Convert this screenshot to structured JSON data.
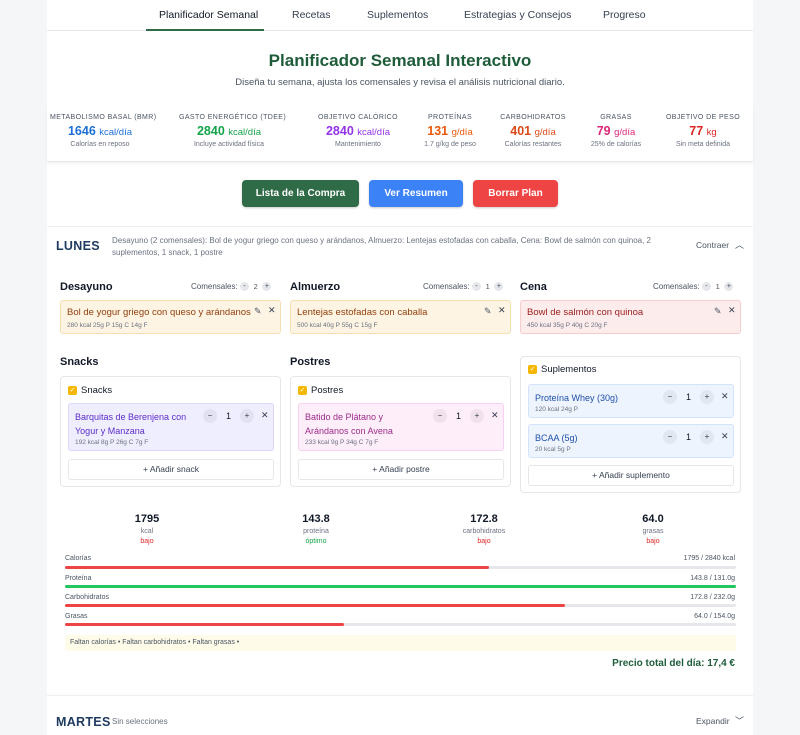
{
  "nav": {
    "tabs": [
      "Planificador Semanal",
      "Recetas",
      "Suplementos",
      "Estrategias y Consejos",
      "Progreso"
    ],
    "active": "Planificador Semanal"
  },
  "header": {
    "title": "Planificador Semanal Interactivo",
    "subtitle": "Diseña tu semana, ajusta los comensales y revisa el análisis nutricional diario."
  },
  "stats": [
    {
      "label": "Metabolismo Basal (BMR)",
      "value": "1646",
      "unit": "kcal/día",
      "note": "Calorías en reposo",
      "color": "#1d6fd6"
    },
    {
      "label": "Gasto Energético (TDEE)",
      "value": "2840",
      "unit": "kcal/día",
      "note": "Incluye actividad física",
      "color": "#16a34a"
    },
    {
      "label": "Objetivo Calórico",
      "value": "2840",
      "unit": "kcal/día",
      "note": "Mantenimiento",
      "color": "#9333ea"
    },
    {
      "label": "Proteínas",
      "value": "131",
      "unit": "g/día",
      "note": "1.7 g/kg de peso",
      "color": "#ea580c"
    },
    {
      "label": "Carbohidratos",
      "value": "401",
      "unit": "g/día",
      "note": "Calorías restantes",
      "color": "#dc4a17"
    },
    {
      "label": "Grasas",
      "value": "79",
      "unit": "g/día",
      "note": "25% de calorías",
      "color": "#db2777"
    },
    {
      "label": "Objetivo de Peso",
      "value": "77",
      "unit": "kg",
      "note": "Sin meta definida",
      "color": "#dc2626"
    }
  ],
  "actions": {
    "shopping": "Lista de la Compra",
    "summary": "Ver Resumen",
    "clear": "Borrar Plan"
  },
  "colors": {
    "brand": "#2f6b46",
    "blue": "#3b82f6",
    "red": "#ef4444"
  },
  "day1": {
    "name": "LUNES",
    "summary_line1": "Desayuno (2 comensales): Bol de yogur griego con queso y arándanos, Almuerzo: Lentejas estofadas con caballa, Cena: Bowl de salmón con quinoa, 2",
    "summary_line2": "suplementos, 1 snack, 1 postre",
    "toggle": "Contraer",
    "meals": [
      {
        "title": "Desayuno",
        "comensales_label": "Comensales:",
        "count": "2",
        "name": "Bol de yogur griego con queso y arándanos",
        "macros": "280 kcal   25g P   15g C   14g F"
      },
      {
        "title": "Almuerzo",
        "comensales_label": "Comensales:",
        "count": "1",
        "name": "Lentejas estofadas con caballa",
        "macros": "500 kcal   40g P   55g C   15g F"
      },
      {
        "title": "Cena",
        "comensales_label": "Comensales:",
        "count": "1",
        "name": "Bowl de salmón con quinoa",
        "macros": "450 kcal   35g P   40g C   20g F"
      }
    ],
    "snacks": {
      "title": "Snacks",
      "check_label": "Snacks",
      "item_line1": "Barquitas de Berenjena con",
      "item_line2": "Yogur y Manzana",
      "item_qty": "1",
      "item_macros": "192 kcal   8g P   26g C   7g F",
      "add": "Añadir snack"
    },
    "postres": {
      "title": "Postres",
      "check_label": "Postres",
      "item_line1": "Batido de Plátano y",
      "item_line2": "Arándanos con Avena",
      "item_qty": "1",
      "item_macros": "233 kcal   9g P   34g C   7g F",
      "add": "Añadir postre"
    },
    "suplementos": {
      "check_label": "Suplementos",
      "items": [
        {
          "name": "Proteína Whey (30g)",
          "qty": "1",
          "macros": "120 kcal   24g P"
        },
        {
          "name": "BCAA (5g)",
          "qty": "1",
          "macros": "20 kcal   5g P"
        }
      ],
      "add": "Añadir suplemento"
    },
    "totals": [
      {
        "value": "1795",
        "name": "kcal",
        "status": "bajo",
        "status_color": "#dc2626"
      },
      {
        "value": "143.8",
        "name": "proteína",
        "status": "óptimo",
        "status_color": "#16a34a"
      },
      {
        "value": "172.8",
        "name": "carbohidratos",
        "status": "bajo",
        "status_color": "#dc2626"
      },
      {
        "value": "64.0",
        "name": "grasas",
        "status": "bajo",
        "status_color": "#dc2626"
      }
    ],
    "bars": [
      {
        "label": "Calorías",
        "value": "1795 / 2840 kcal",
        "fraction": 0.632,
        "color": "#ef4444"
      },
      {
        "label": "Proteína",
        "value": "143.8 / 131.0g",
        "fraction": 1.0,
        "color": "#22c55e"
      },
      {
        "label": "Carbohidratos",
        "value": "172.8 / 232.0g",
        "fraction": 0.745,
        "color": "#ef4444"
      },
      {
        "label": "Grasas",
        "value": "64.0 / 154.0g",
        "fraction": 0.416,
        "color": "#ef4444"
      }
    ],
    "warnings": "Faltan calorías • Faltan carbohidratos • Faltan grasas •",
    "price": "Precio total del día: 17,4 €"
  },
  "day2": {
    "name": "MARTES",
    "summary": "Sin selecciones",
    "toggle": "Expandir"
  }
}
